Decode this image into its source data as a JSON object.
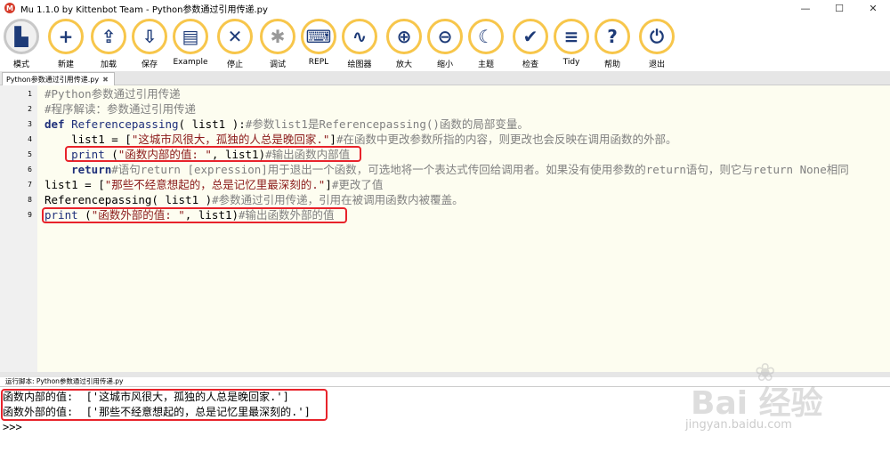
{
  "window": {
    "title": "Mu 1.1.0 by Kittenbot Team - Python参数通过引用传递.py",
    "controls": [
      "—",
      "☐",
      "✕"
    ]
  },
  "toolbar": {
    "buttons": [
      {
        "label": "模式",
        "icon": "mode-icon",
        "glyph": "▙"
      },
      {
        "label": "新建",
        "icon": "plus-icon",
        "glyph": "+"
      },
      {
        "label": "加载",
        "icon": "upload-icon",
        "glyph": "⇪"
      },
      {
        "label": "保存",
        "icon": "download-icon",
        "glyph": "⇩"
      },
      {
        "label": "Example",
        "icon": "example-icon",
        "glyph": "▤"
      },
      {
        "label": "停止",
        "icon": "stop-icon",
        "glyph": "✕"
      },
      {
        "label": "调试",
        "icon": "bug-icon",
        "glyph": "✱"
      },
      {
        "label": "REPL",
        "icon": "keyboard-icon",
        "glyph": "⌨"
      },
      {
        "label": "绘图器",
        "icon": "plotter-icon",
        "glyph": "∿"
      },
      {
        "label": "放大",
        "icon": "zoom-in-icon",
        "glyph": "⊕"
      },
      {
        "label": "缩小",
        "icon": "zoom-out-icon",
        "glyph": "⊖"
      },
      {
        "label": "主题",
        "icon": "moon-icon",
        "glyph": "☾"
      },
      {
        "label": "检查",
        "icon": "thumbs-up-icon",
        "glyph": "✔"
      },
      {
        "label": "Tidy",
        "icon": "tidy-icon",
        "glyph": "≡"
      },
      {
        "label": "帮助",
        "icon": "help-icon",
        "glyph": "?"
      },
      {
        "label": "退出",
        "icon": "power-icon",
        "glyph": "⏻"
      }
    ]
  },
  "tab": {
    "label": "Python参数通过引用传递.py",
    "close": "✖"
  },
  "editor": {
    "line_numbers": [
      "1",
      "2",
      "3",
      "4",
      "5",
      "6",
      "7",
      "8",
      "9"
    ],
    "lines": [
      [
        {
          "t": "#Python参数通过引用传递",
          "c": "comment"
        }
      ],
      [
        {
          "t": "#程序解读：参数通过引用传递",
          "c": "comment"
        }
      ],
      [
        {
          "t": "def ",
          "c": "kw"
        },
        {
          "t": "Referencepassing",
          "c": "name"
        },
        {
          "t": "( list1 ):",
          "c": "plain"
        },
        {
          "t": "#参数list1是Referencepassing()函数的局部变量。",
          "c": "comment"
        }
      ],
      [
        {
          "t": "    list1 = [",
          "c": "plain"
        },
        {
          "t": "\"这城市风很大，孤独的人总是晚回家.\"",
          "c": "str"
        },
        {
          "t": "]",
          "c": "plain"
        },
        {
          "t": "#在函数中更改参数所指的内容，则更改也会反映在调用函数的外部。",
          "c": "comment"
        }
      ],
      [
        {
          "t": "    print ",
          "c": "name"
        },
        {
          "t": "(",
          "c": "plain"
        },
        {
          "t": "\"函数内部的值: \"",
          "c": "str"
        },
        {
          "t": ", list1)",
          "c": "plain"
        },
        {
          "t": "#输出函数内部值",
          "c": "comment"
        }
      ],
      [
        {
          "t": "    return",
          "c": "kw"
        },
        {
          "t": "#语句return [expression]用于退出一个函数，可选地将一个表达式传回给调用者。如果没有使用参数的return语句，则它与return None相同",
          "c": "comment"
        }
      ],
      [
        {
          "t": "list1 = [",
          "c": "plain"
        },
        {
          "t": "\"那些不经意想起的，总是记忆里最深刻的.\"",
          "c": "str"
        },
        {
          "t": "]",
          "c": "plain"
        },
        {
          "t": "#更改了值",
          "c": "comment"
        }
      ],
      [
        {
          "t": "Referencepassing( list1 )",
          "c": "plain"
        },
        {
          "t": "#参数通过引用传递，引用在被调用函数内被覆盖。",
          "c": "comment"
        }
      ],
      [
        {
          "t": "print ",
          "c": "name"
        },
        {
          "t": "(",
          "c": "plain"
        },
        {
          "t": "\"函数外部的值: \"",
          "c": "str"
        },
        {
          "t": ", list1)",
          "c": "plain"
        },
        {
          "t": "#输出函数外部的值",
          "c": "comment"
        }
      ]
    ]
  },
  "runner": {
    "header": "运行脚本: Python参数通过引用传递.py",
    "output": [
      "函数内部的值:  ['这城市风很大，孤独的人总是晚回家.']",
      "函数外部的值:  ['那些不经意想起的，总是记忆里最深刻的.']",
      ">>>"
    ]
  },
  "watermark": {
    "brand": "Bai 经验",
    "url": "jingyan.baidu.com"
  },
  "colors": {
    "accent": "#f7c64b",
    "highlight_box": "#e8232b",
    "editor_bg": "#fdfdf0"
  }
}
